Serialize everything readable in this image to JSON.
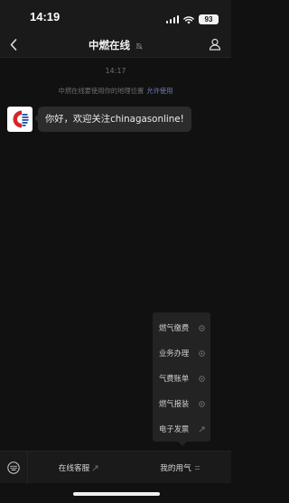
{
  "status_bar": {
    "time": "14:19",
    "battery": "93",
    "icons": [
      "signal-icon",
      "wifi-icon",
      "battery-icon"
    ]
  },
  "header": {
    "title": "中燃在线",
    "icons": [
      "back-chevron-icon",
      "mute-bell-icon",
      "profile-icon"
    ]
  },
  "chat": {
    "timestamp": "14:17",
    "location_notice": {
      "text": "中燃在线要使用你的地理位置",
      "action": "允许使用"
    },
    "messages": [
      {
        "sender_avatar": "china-gas-logo",
        "text": "你好，欢迎关注chinagasonline!"
      }
    ]
  },
  "submenu": {
    "items": [
      {
        "label": "燃气缴费",
        "icon": "mini-program-icon"
      },
      {
        "label": "业务办理",
        "icon": "mini-program-icon"
      },
      {
        "label": "气费账单",
        "icon": "mini-program-icon"
      },
      {
        "label": "燃气报装",
        "icon": "mini-program-icon"
      },
      {
        "label": "电子发票",
        "icon": "link-icon"
      }
    ]
  },
  "bottom_menu": {
    "items": [
      {
        "label": "在线客服",
        "icon": "link-icon"
      },
      {
        "label": "我的用气",
        "icon": "menu-lines-icon"
      }
    ],
    "keyboard_icon": "keyboard-icon"
  },
  "colors": {
    "background": "#111111",
    "bar_background": "#1a1a1a",
    "bubble": "#2c2c2c",
    "link": "#6c7fb3",
    "brand_red": "#d6262b",
    "brand_blue": "#1f4fa3"
  }
}
